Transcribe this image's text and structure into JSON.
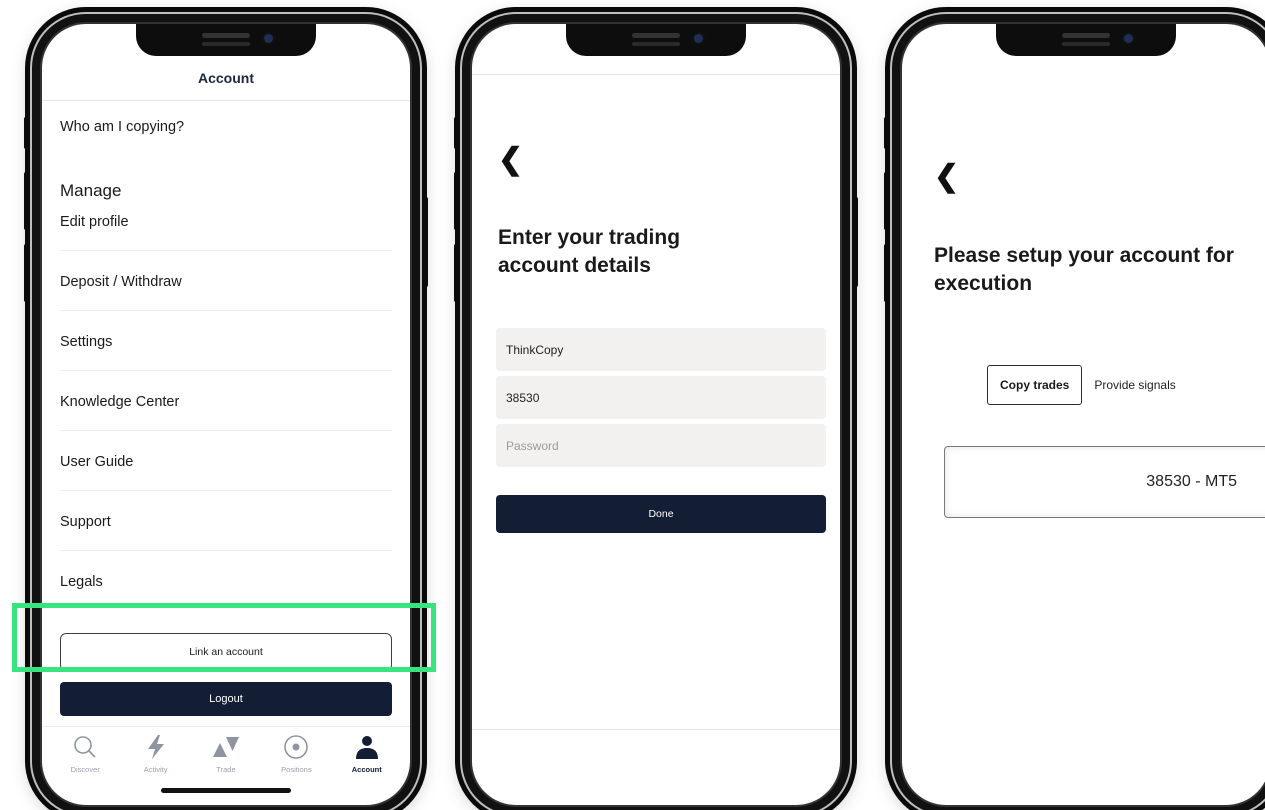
{
  "phone1": {
    "header_title": "Account",
    "menu": {
      "who_am_i_copying": "Who am I copying?",
      "manage_heading": "Manage",
      "edit_profile": "Edit profile",
      "deposit_withdraw": "Deposit / Withdraw",
      "settings": "Settings",
      "knowledge_center": "Knowledge Center",
      "user_guide": "User Guide",
      "support": "Support",
      "legals": "Legals"
    },
    "link_account_label": "Link an account",
    "logout_label": "Logout",
    "tabs": [
      {
        "label": "Discover",
        "icon": "search-icon"
      },
      {
        "label": "Activity",
        "icon": "lightning-icon"
      },
      {
        "label": "Trade",
        "icon": "trade-icon"
      },
      {
        "label": "Positions",
        "icon": "positions-icon"
      },
      {
        "label": "Account",
        "icon": "person-icon"
      }
    ],
    "active_tab": "Account",
    "highlight_color": "#37e47f"
  },
  "phone2": {
    "back_glyph": "❮",
    "title": "Enter your trading account details",
    "fields": {
      "server_value": "ThinkCopy",
      "account_value": "38530",
      "password_placeholder": "Password"
    },
    "done_label": "Done"
  },
  "phone3": {
    "back_glyph": "❮",
    "title": "Please setup your account for execution",
    "toggle": {
      "active": "Copy trades",
      "inactive": "Provide signals"
    },
    "account_label": "38530 - MT5"
  },
  "colors": {
    "primary_dark": "#131d33"
  }
}
